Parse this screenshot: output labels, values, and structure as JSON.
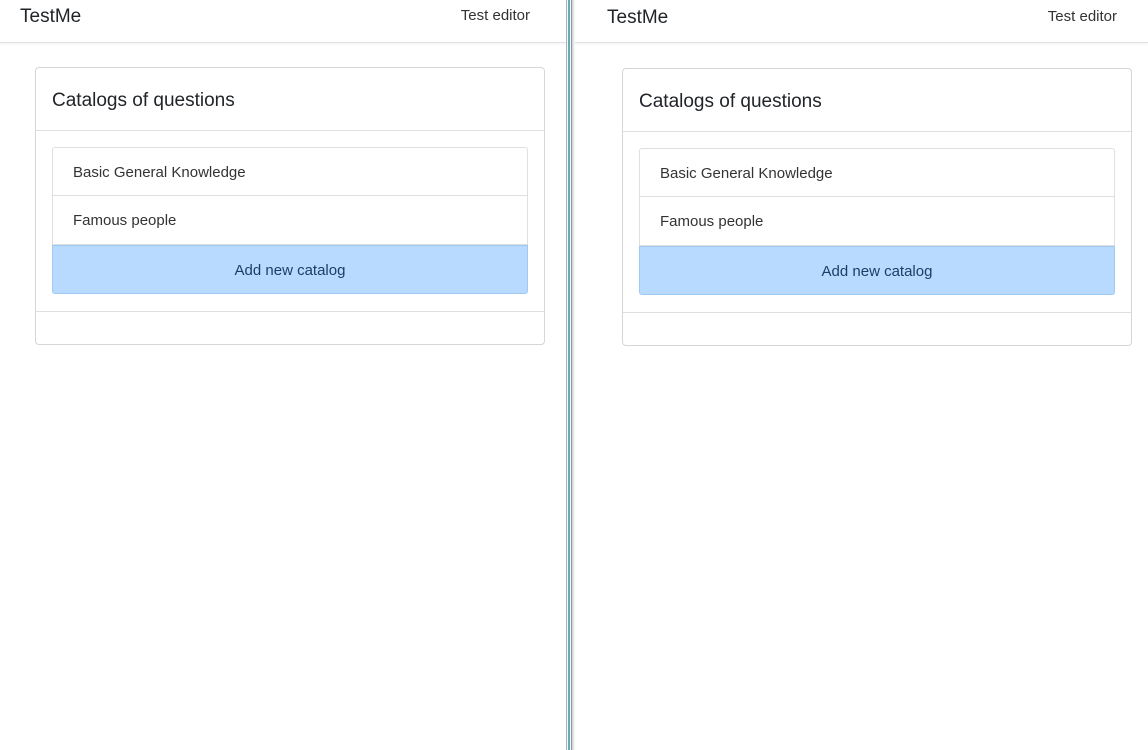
{
  "panes": [
    {
      "navbar": {
        "brand": "TestMe",
        "link": "Test editor"
      },
      "card": {
        "title": "Catalogs of questions",
        "items": [
          "Basic General Knowledge",
          "Famous people"
        ],
        "add_label": "Add new catalog"
      }
    },
    {
      "navbar": {
        "brand": "TestMe",
        "link": "Test editor"
      },
      "card": {
        "title": "Catalogs of questions",
        "items": [
          "Basic General Knowledge",
          "Famous people"
        ],
        "add_label": "Add new catalog"
      }
    }
  ],
  "colors": {
    "add_button_bg": "#b8daff",
    "add_button_text": "#1c3e66",
    "border": "#dfdfdf"
  }
}
